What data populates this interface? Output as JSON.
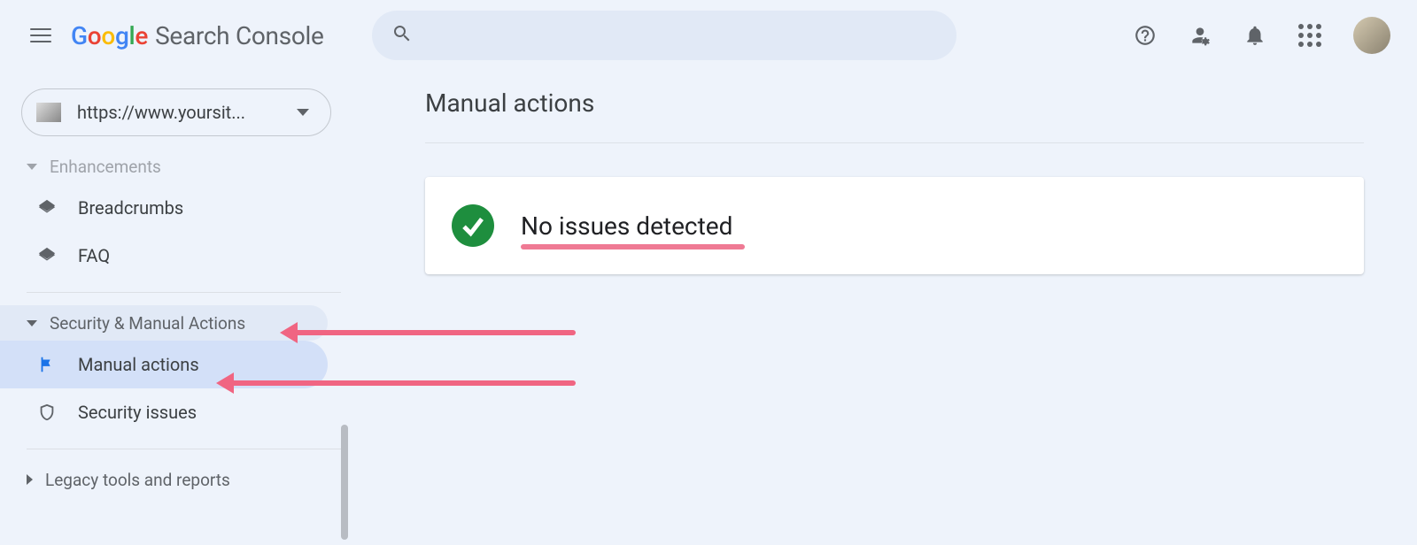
{
  "header": {
    "logo_product": "Search Console",
    "search_placeholder": ""
  },
  "property": {
    "url": "https://www.yoursit..."
  },
  "sidebar": {
    "enhancements_label": "Enhancements",
    "breadcrumbs_label": "Breadcrumbs",
    "faq_label": "FAQ",
    "security_section_label": "Security & Manual Actions",
    "manual_actions_label": "Manual actions",
    "security_issues_label": "Security issues",
    "legacy_label": "Legacy tools and reports"
  },
  "main": {
    "page_title": "Manual actions",
    "status_message": "No issues detected"
  }
}
